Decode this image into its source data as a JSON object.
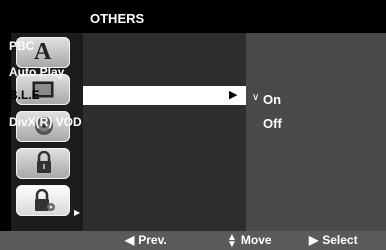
{
  "title": "OTHERS",
  "sidebar": {
    "icons": [
      {
        "name": "language-icon",
        "glyph": "A"
      },
      {
        "name": "display-icon"
      },
      {
        "name": "audio-icon"
      },
      {
        "name": "lock-icon"
      },
      {
        "name": "others-icon",
        "selected": true
      }
    ]
  },
  "menu": {
    "items": [
      {
        "label": "PBC"
      },
      {
        "label": "Auto Play"
      },
      {
        "label": "B.L.E",
        "active": true
      },
      {
        "label": "DivX(R) VOD"
      }
    ]
  },
  "submenu": {
    "check_mark": "∨",
    "options": [
      {
        "label": "On"
      },
      {
        "label": "Off"
      }
    ]
  },
  "bottom_bar": {
    "prev": "Prev.",
    "move": "Move",
    "select": "Select"
  },
  "colors": {
    "background": "#000000",
    "menu_bg": "#2e2e2e",
    "submenu_bg": "#4a4a4a",
    "highlight": "#ffffff",
    "bottom_bar": "#5a5a5a"
  }
}
